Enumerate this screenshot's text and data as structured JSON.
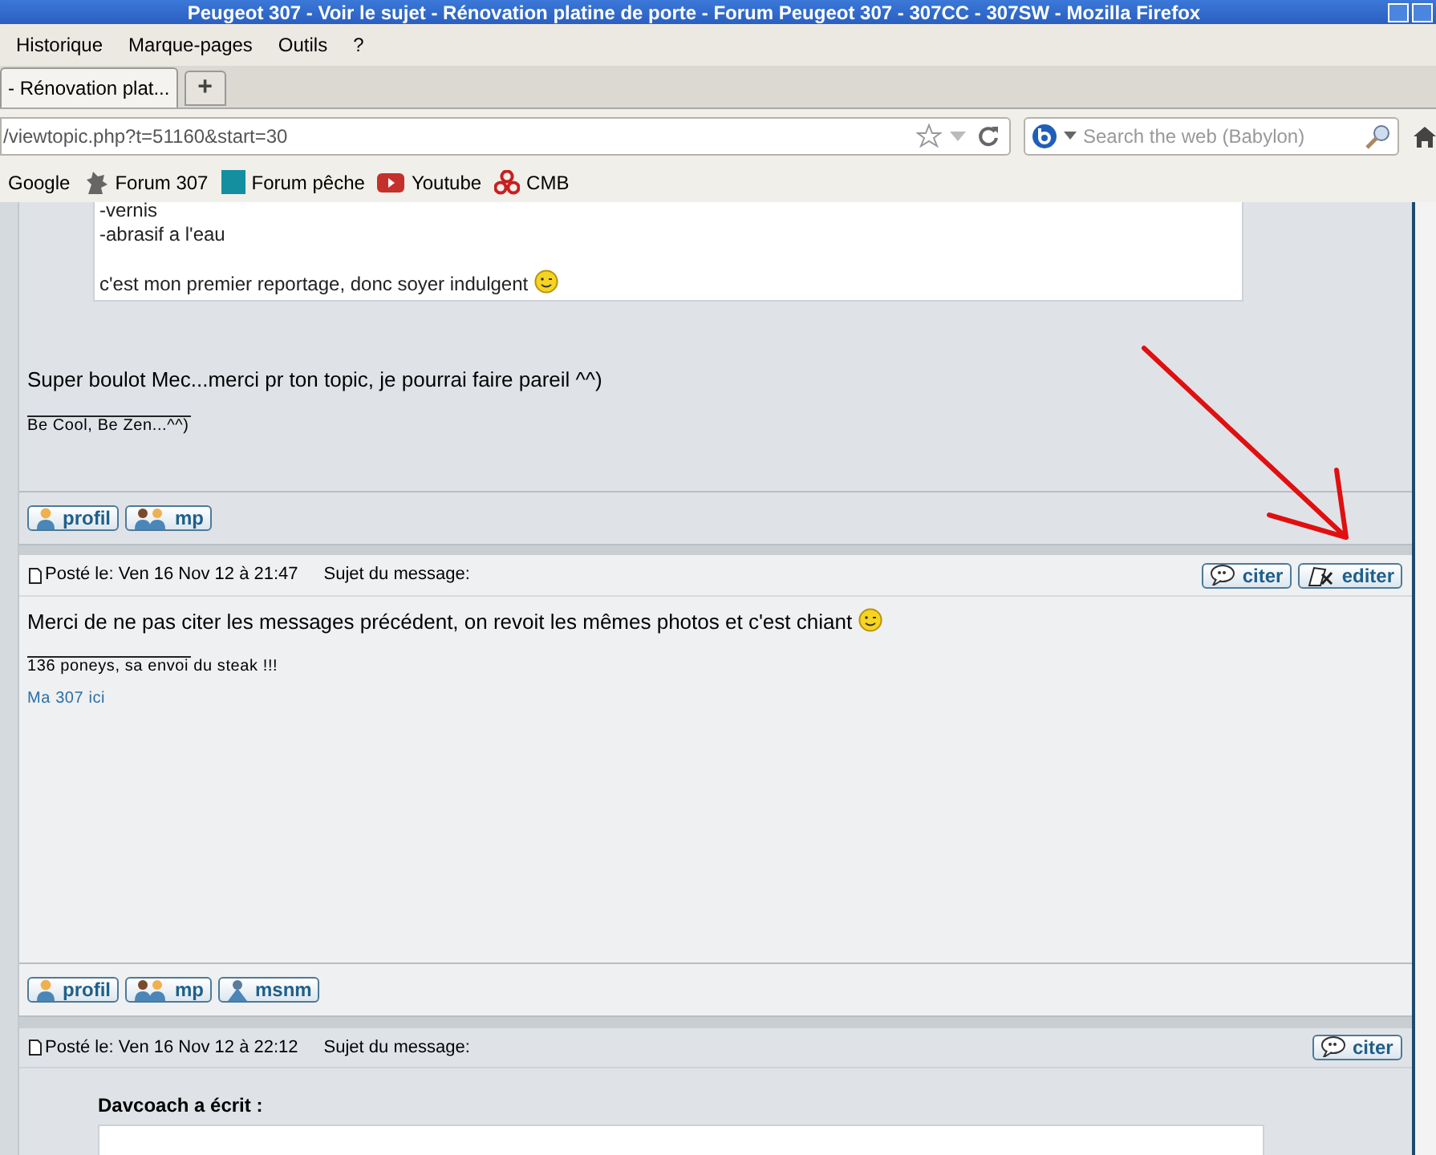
{
  "window": {
    "title": "Peugeot 307 - Voir le sujet - Rénovation platine de porte - Forum Peugeot 307 - 307CC - 307SW - Mozilla Firefox"
  },
  "menu": [
    "Historique",
    "Marque-pages",
    "Outils",
    "?"
  ],
  "tabs": [
    {
      "label": "- Rénovation plat...",
      "selected": true
    }
  ],
  "new_tab": "+",
  "address": {
    "value": "/viewtopic.php?t=51160&start=30"
  },
  "search": {
    "placeholder": "Search the web (Babylon)"
  },
  "bookmarks": [
    {
      "label": "Google",
      "kind": "plain"
    },
    {
      "label": "Forum 307",
      "kind": "lion"
    },
    {
      "label": "Forum pêche",
      "kind": "gp"
    },
    {
      "label": "Youtube",
      "kind": "youtube"
    },
    {
      "label": "CMB",
      "kind": "cmb"
    }
  ],
  "quote_paragraphs": [
    [
      "-vernis",
      "-abrasif a l'eau"
    ],
    [
      "c'est mon premier reportage, donc soyer indulgent"
    ]
  ],
  "posts": [
    {
      "body": "Super boulot Mec...merci pr ton topic, je pourrai faire pareil ^^)",
      "smiley": false,
      "signature": [
        "Be Cool, Be Zen...^^)"
      ],
      "buttons": [
        "profil",
        "mp"
      ]
    },
    {
      "header": {
        "posted": "Posté le: Ven 16 Nov 12 à 21:47",
        "subject": "Sujet du message:",
        "actions": [
          "citer",
          "editer"
        ]
      },
      "body": "Merci de ne pas citer les messages précédent, on revoit les mêmes photos et c'est chiant",
      "smiley": true,
      "signature": [
        "136 poneys, sa envoi du steak !!!"
      ],
      "link": "Ma 307 ici",
      "buttons": [
        "profil",
        "mp",
        "msnm"
      ]
    }
  ],
  "last_post": {
    "posted": "Posté le: Ven 16 Nov 12 à 22:12",
    "subject": "Sujet du message:",
    "actions": [
      "citer"
    ],
    "quote_author": "Davcoach a écrit :"
  }
}
